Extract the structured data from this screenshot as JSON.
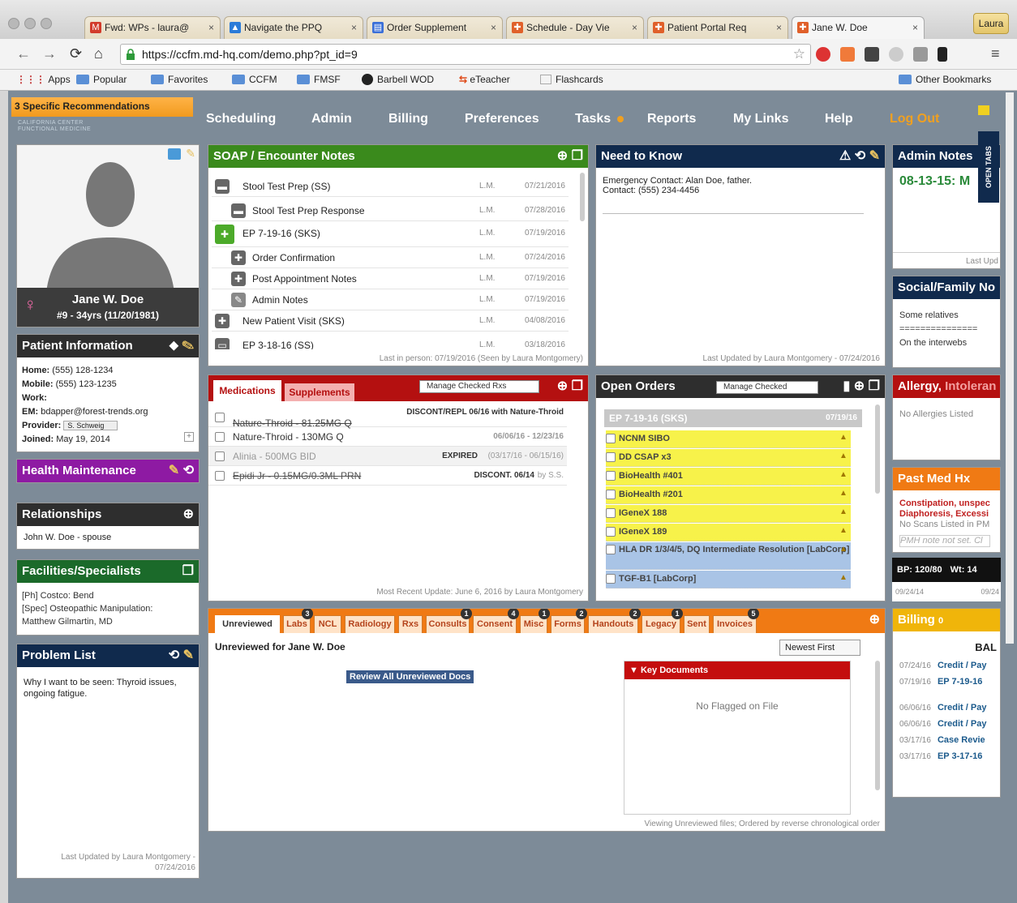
{
  "browser": {
    "tabs": [
      {
        "label": "Fwd: WPs - laura@",
        "icon": "gmail-icon",
        "color": "#d23c2c",
        "glyph": "M"
      },
      {
        "label": "Navigate the PPQ",
        "icon": "docs-icon",
        "color": "#2b7bd8",
        "glyph": "▲"
      },
      {
        "label": "Order Supplement",
        "icon": "doc-icon",
        "color": "#3a6fd8",
        "glyph": "▤"
      },
      {
        "label": "Schedule - Day Vie",
        "icon": "ccfm-icon",
        "color": "#e0602a",
        "glyph": "✚"
      },
      {
        "label": "Patient Portal Req",
        "icon": "ccfm-icon",
        "color": "#e0602a",
        "glyph": "✚"
      },
      {
        "label": "Jane W. Doe",
        "icon": "ccfm-icon",
        "color": "#e0602a",
        "glyph": "✚"
      }
    ],
    "profile": "Laura",
    "url": "https://ccfm.md-hq.com/demo.php?pt_id=9",
    "bookmarks": [
      "Apps",
      "Popular",
      "Favorites",
      "CCFM",
      "FMSF",
      "Barbell WOD",
      "eTeacher",
      "Flashcards"
    ],
    "other_bookmarks": "Other Bookmarks"
  },
  "app": {
    "alert": "3 Specific Recommendations",
    "logo_line1": "CALIFORNIA CENTER",
    "logo_line2": "FUNCTIONAL MEDICINE",
    "nav": [
      "Scheduling",
      "Admin",
      "Billing",
      "Preferences",
      "Tasks",
      "Reports",
      "My Links",
      "Help",
      "Log Out"
    ]
  },
  "patient": {
    "name": "Jane W. Doe",
    "id_line": "#9 - 34yrs (11/20/1981)",
    "info_title": "Patient Information",
    "home_label": "Home:",
    "home": "(555) 128-1234",
    "mobile_label": "Mobile:",
    "mobile": "(555) 123-1235",
    "work_label": "Work:",
    "em_label": "EM:",
    "em": "bdapper@forest-trends.org",
    "provider_label": "Provider:",
    "provider": "S. Schweig",
    "joined_label": "Joined:",
    "joined": "May 19, 2014"
  },
  "health_title": "Health Maintenance",
  "relationships": {
    "title": "Relationships",
    "item": "John W. Doe - spouse"
  },
  "facilities": {
    "title": "Facilities/Specialists",
    "line1": "[Ph] Costco: Bend",
    "line2": "[Spec] Osteopathic Manipulation:",
    "line3": "Matthew Gilmartin, MD"
  },
  "problems": {
    "title": "Problem List",
    "text": "Why I want to be seen: Thyroid issues, ongoing fatigue.",
    "updated1": "Last Updated by Laura Montgomery -",
    "updated2": "07/24/2016"
  },
  "soap": {
    "title": "SOAP / Encounter Notes",
    "rows": [
      {
        "label": "Stool Test Prep (SS)",
        "author": "L.M.",
        "date": "07/21/2016"
      },
      {
        "label": "Stool Test Prep Response",
        "author": "L.M.",
        "date": "07/28/2016"
      },
      {
        "label": "EP 7-19-16 (SKS)",
        "author": "L.M.",
        "date": "07/19/2016"
      },
      {
        "label": "Order Confirmation",
        "author": "L.M.",
        "date": "07/24/2016"
      },
      {
        "label": "Post Appointment Notes",
        "author": "L.M.",
        "date": "07/19/2016"
      },
      {
        "label": "Admin Notes",
        "author": "L.M.",
        "date": "07/19/2016"
      },
      {
        "label": "New Patient Visit (SKS)",
        "author": "L.M.",
        "date": "04/08/2016"
      },
      {
        "label": "EP 3-18-16 (SS)",
        "author": "L.M.",
        "date": "03/18/2016"
      }
    ],
    "footer": "Last in person: 07/19/2016 (Seen by Laura Montgomery)"
  },
  "need": {
    "title": "Need to Know",
    "line1": "Emergency Contact: Alan Doe, father.",
    "line2": "Contact: (555) 234-4456",
    "footer": "Last Updated by Laura Montgomery - 07/24/2016"
  },
  "admin_notes": {
    "title": "Admin Notes",
    "text": "08-13-15: M",
    "footer": "Last Upd"
  },
  "open_tabs": "OPEN TABS",
  "social": {
    "title": "Social/Family No",
    "line1": "Some relatives",
    "line2": "===============",
    "line3": "On the interwebs"
  },
  "meds": {
    "tab1": "Medications",
    "tab2": "Supplements",
    "manage": "Manage Checked Rxs",
    "rows": [
      {
        "name": "Nature-Throid - 81.25MG Q",
        "status": "DISCONT/REPL 06/16 with Nature-Throid",
        "dates": ""
      },
      {
        "name": "Nature-Throid - 130MG Q",
        "status": "",
        "dates": "06/06/16 - 12/23/16"
      },
      {
        "name": "Alinia - 500MG BID",
        "status": "EXPIRED",
        "dates": "(03/17/16 - 06/15/16)"
      },
      {
        "name": "Epidi Jr - 0.15MG/0.3ML PRN",
        "status": "DISCONT. 06/14",
        "dates": "by S.S."
      }
    ],
    "footer": "Most Recent Update: June 6, 2016 by Laura Montgomery"
  },
  "orders": {
    "title": "Open Orders",
    "manage": "Manage Checked",
    "group": "EP 7-19-16 (SKS)",
    "group_date": "07/19/16",
    "rows": [
      "NCNM SIBO",
      "DD CSAP x3",
      "BioHealth #401",
      "BioHealth #201",
      "IGeneX 188",
      "IGeneX 189",
      "HLA DR 1/3/4/5, DQ Intermediate Resolution [LabCorp]",
      "TGF-B1 [LabCorp]"
    ]
  },
  "allergy": {
    "title1": "Allergy, ",
    "title2": "Intoleran",
    "text": "No Allergies Listed"
  },
  "pmh": {
    "title": "Past Med Hx",
    "line1": "Constipation, unspec",
    "line2": "Diaphoresis, Excessi",
    "line3": "No Scans Listed in PM",
    "line4": "PMH note not set. Cl"
  },
  "vitals": {
    "bp": "BP: 120/80",
    "wt": "Wt: 14",
    "d1": "09/24/14",
    "d2": "09/24"
  },
  "billing": {
    "title": "Billing",
    "count": "0",
    "bal": "BAL",
    "rows": [
      {
        "date": "07/24/16",
        "text": "Credit / Pay"
      },
      {
        "date": "07/19/16",
        "text": "EP 7-19-16"
      },
      {
        "date": "06/06/16",
        "text": "Credit / Pay"
      },
      {
        "date": "06/06/16",
        "text": "Credit / Pay"
      },
      {
        "date": "03/17/16",
        "text": "Case Revie"
      },
      {
        "date": "03/17/16",
        "text": "EP 3-17-16"
      }
    ]
  },
  "docs": {
    "tabs": [
      {
        "label": "Unreviewed",
        "badge": ""
      },
      {
        "label": "Labs",
        "badge": "3"
      },
      {
        "label": "NCL",
        "badge": ""
      },
      {
        "label": "Radiology",
        "badge": ""
      },
      {
        "label": "Rxs",
        "badge": ""
      },
      {
        "label": "Consults",
        "badge": "1"
      },
      {
        "label": "Consent",
        "badge": "4"
      },
      {
        "label": "Misc",
        "badge": "1"
      },
      {
        "label": "Forms",
        "badge": "2"
      },
      {
        "label": "Handouts",
        "badge": "2"
      },
      {
        "label": "Legacy",
        "badge": "1"
      },
      {
        "label": "Sent",
        "badge": ""
      },
      {
        "label": "Invoices",
        "badge": "5"
      }
    ],
    "heading": "Unreviewed for Jane W. Doe",
    "sort": "Newest First",
    "review_btn": "Review All Unreviewed Docs",
    "key_docs": "Key Documents",
    "no_flagged": "No Flagged on File",
    "footer": "Viewing Unreviewed files; Ordered by reverse chronological order"
  }
}
